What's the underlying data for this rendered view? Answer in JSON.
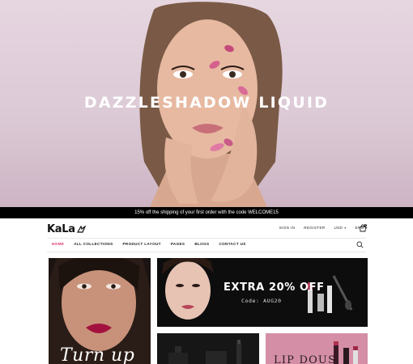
{
  "hero": {
    "title": "DAZZLESHADOW LIQUID"
  },
  "promo": {
    "text": "15% off the shipping of your first order with the code WELCOME15"
  },
  "header": {
    "logo_text": "KaLa",
    "sign_in": "SIGN IN",
    "register": "REGISTER",
    "currency": "USD",
    "language": "ENG",
    "cart_count": "0"
  },
  "nav": {
    "items": [
      "HOME",
      "ALL COLLECTIONS",
      "PRODUCT LAYOUT",
      "PAGES",
      "BLOGS",
      "CONTACT US"
    ]
  },
  "banners": {
    "left_text": "Turn up",
    "right_headline": "EXTRA 20% OFF",
    "right_code": "Code: AUG20",
    "bottom_right_text": "LIP DOUS"
  },
  "colors": {
    "accent": "#e1306c",
    "promo_bg": "#000000",
    "hero_bg": "#dccad6"
  },
  "icons": [
    "cart-icon",
    "search-icon",
    "chevron-down-icon"
  ]
}
